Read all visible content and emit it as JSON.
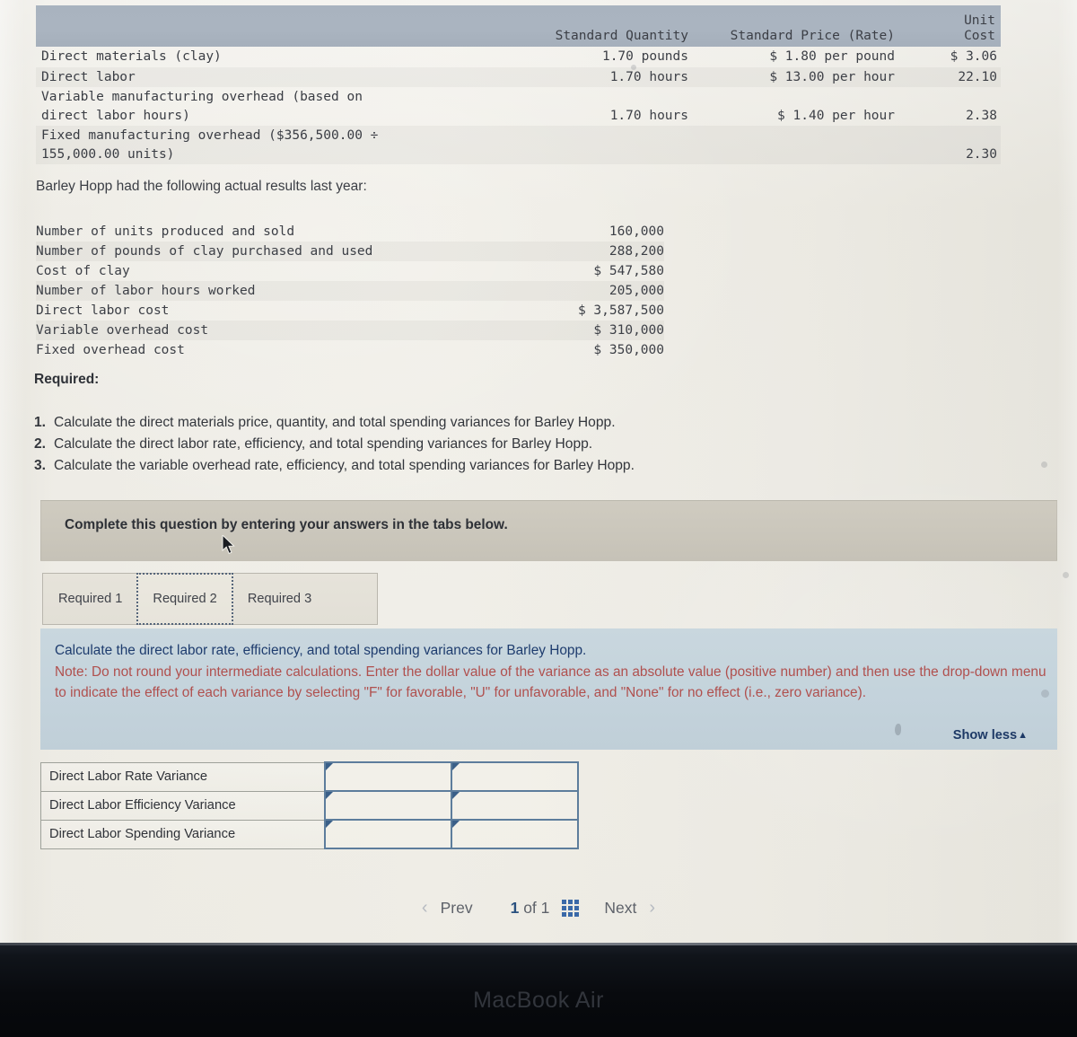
{
  "standard_table": {
    "headers": [
      "",
      "Standard Quantity",
      "Standard Price (Rate)",
      "Unit\nCost"
    ],
    "rows": [
      {
        "label": "Direct materials (clay)",
        "quantity": "1.70 pounds",
        "rate": "$ 1.80 per pound",
        "unit_cost": "$ 3.06"
      },
      {
        "label": "Direct labor",
        "quantity": "1.70 hours",
        "rate": "$ 13.00 per hour",
        "unit_cost": "22.10"
      },
      {
        "label": "Variable manufacturing overhead (based on\n   direct labor hours)",
        "quantity": "1.70 hours",
        "rate": "$ 1.40 per hour",
        "unit_cost": "2.38"
      },
      {
        "label": "Fixed manufacturing overhead ($356,500.00 ÷\n  155,000.00 units)",
        "quantity": "",
        "rate": "",
        "unit_cost": "2.30"
      }
    ]
  },
  "actual": {
    "intro": "Barley Hopp had the following actual results last year:",
    "rows": [
      {
        "label": "Number of units produced and sold",
        "value": "160,000"
      },
      {
        "label": "Number of pounds of clay purchased and used",
        "value": "288,200"
      },
      {
        "label": "Cost of clay",
        "value": "$ 547,580"
      },
      {
        "label": "Number of labor hours worked",
        "value": "205,000"
      },
      {
        "label": "Direct labor cost",
        "value": "$ 3,587,500"
      },
      {
        "label": "Variable overhead cost",
        "value": "$ 310,000"
      },
      {
        "label": "Fixed overhead cost",
        "value": "$ 350,000"
      }
    ]
  },
  "required": {
    "heading": "Required:",
    "items": [
      {
        "num": "1.",
        "text": "Calculate the direct materials price, quantity, and total spending variances for Barley Hopp."
      },
      {
        "num": "2.",
        "text": "Calculate the direct labor rate, efficiency, and total spending variances for Barley Hopp."
      },
      {
        "num": "3.",
        "text": "Calculate the variable overhead rate, efficiency, and total spending variances for Barley Hopp."
      }
    ]
  },
  "banner": {
    "text": "Complete this question by entering your answers in the tabs below."
  },
  "tabs": [
    {
      "label": "Required 1",
      "active": false
    },
    {
      "label": "Required 2",
      "active": true
    },
    {
      "label": "Required 3",
      "active": false
    }
  ],
  "info": {
    "line1": "Calculate the direct labor rate, efficiency, and total spending variances for Barley Hopp.",
    "note": "Note: Do not round your intermediate calculations. Enter the dollar value of the variance as an absolute value (positive number) and then use the drop-down menu to indicate the effect of each variance by selecting \"F\" for favorable, \"U\" for unfavorable, and \"None\" for no effect (i.e., zero variance).",
    "show_less_label": "Show less",
    "show_less_icon": "▲"
  },
  "answer_table": {
    "rows": [
      {
        "label": "Direct Labor Rate Variance",
        "amount": "",
        "effect": ""
      },
      {
        "label": "Direct Labor Efficiency Variance",
        "amount": "",
        "effect": ""
      },
      {
        "label": "Direct Labor Spending Variance",
        "amount": "",
        "effect": ""
      }
    ]
  },
  "pager": {
    "prev_label": "Prev",
    "next_label": "Next",
    "prev_icon": "‹",
    "next_icon": "›",
    "current_page": "1",
    "of_label": "of",
    "total_pages": "1",
    "grid_icon": "grid-icon"
  },
  "device": {
    "logo": "MacBook Air"
  },
  "colors": {
    "header_band": "#a9b3bf",
    "banner": "#cbc7bc",
    "info_panel": "#c4d3dc",
    "info_blue_text": "#1e3c6e",
    "note_red": "#b0504e",
    "input_border": "#5d7d9c",
    "accent_blue": "#3a69a8"
  }
}
